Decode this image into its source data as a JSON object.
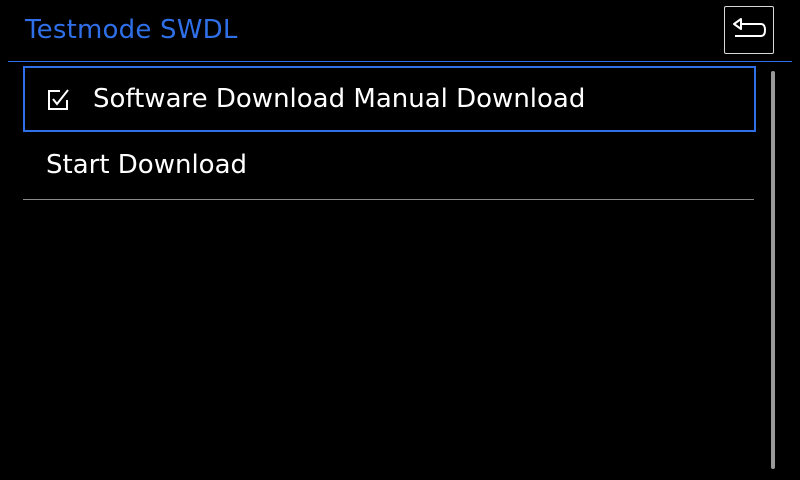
{
  "header": {
    "title": "Testmode SWDL",
    "back_icon": "back-arrow-icon",
    "accent_color": "#2f6fe8"
  },
  "menu": {
    "items": [
      {
        "label": "Software Download Manual Download",
        "checked": true,
        "selected": true,
        "icon": "checkbox-checked-icon"
      },
      {
        "label": "Start Download",
        "selected": false
      }
    ]
  }
}
